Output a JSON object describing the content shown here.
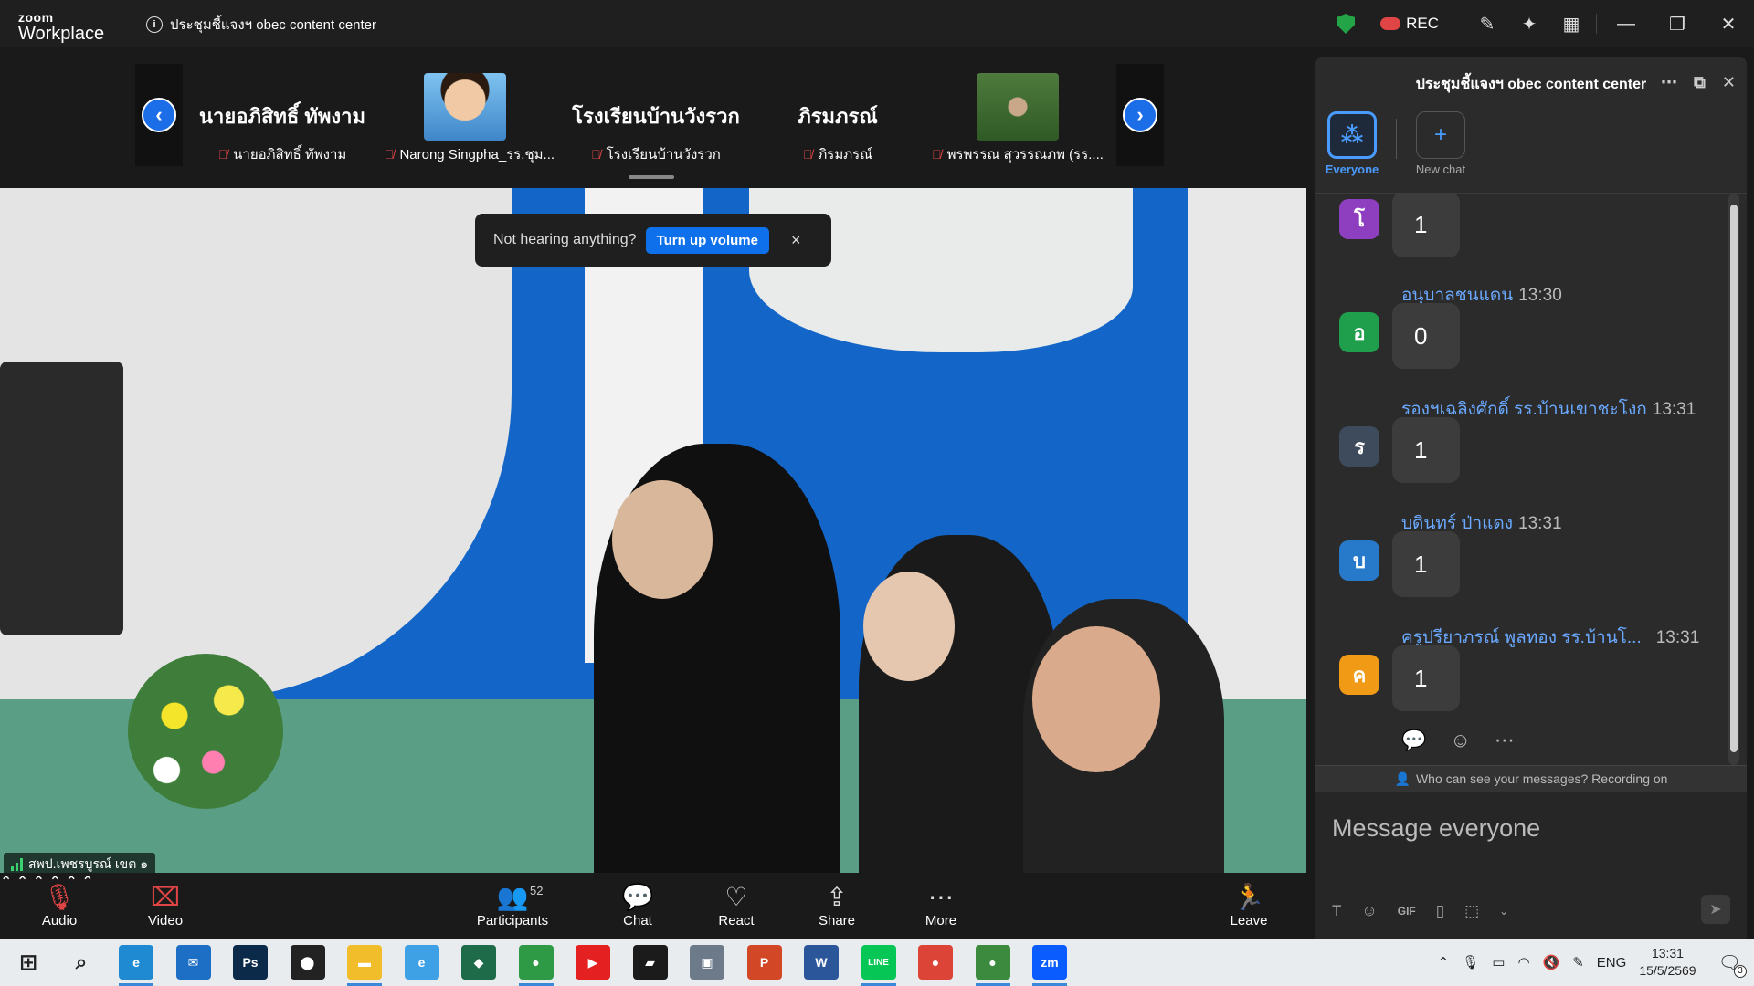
{
  "app": {
    "logo_top": "zoom",
    "logo_bottom": "Workplace",
    "meeting_title": "ประชุมชี้แจงฯ obec content center",
    "rec_label": "REC"
  },
  "thumbnails": [
    {
      "big_name": "นายอภิสิทธิ์ ทัพงาม",
      "label": "นายอภิสิทธิ์ ทัพงาม"
    },
    {
      "big_name": "",
      "label": "Narong Singpha_รร.ชุม..."
    },
    {
      "big_name": "โรงเรียนบ้านวังรวก",
      "label": "โรงเรียนบ้านวังรวก"
    },
    {
      "big_name": "ภิรมภรณ์",
      "label": "ภิรมภรณ์"
    },
    {
      "big_name": "",
      "label": "พรพรรณ สุวรรณภพ (รร...."
    }
  ],
  "toast": {
    "text": "Not hearing anything?",
    "button": "Turn up volume",
    "close": "×"
  },
  "video": {
    "speaker_label": "สพป.เพชรบูรณ์ เขต ๑"
  },
  "controls": {
    "audio": "Audio",
    "video": "Video",
    "participants": "Participants",
    "participants_count": "52",
    "chat": "Chat",
    "react": "React",
    "share": "Share",
    "more": "More",
    "leave": "Leave"
  },
  "chat_panel": {
    "title": "ประชุมชี้แจงฯ obec content center",
    "tabs": [
      {
        "label": "Everyone"
      },
      {
        "label": "New chat"
      }
    ],
    "messages": [
      {
        "initial": "โ",
        "color": "#8e3fbf",
        "name": "",
        "time": "",
        "text": "1"
      },
      {
        "initial": "อ",
        "color": "#1f9e4c",
        "name": "อนุบาลชนแดน",
        "time": "13:30",
        "text": "0"
      },
      {
        "initial": "ร",
        "color": "#3d4b5c",
        "name": "รองฯเฉลิงศักดิ์ รร.บ้านเขาชะโงก",
        "time": "13:31",
        "text": "1"
      },
      {
        "initial": "บ",
        "color": "#2779c9",
        "name": "บดินทร์ ป่าแดง",
        "time": "13:31",
        "text": "1"
      },
      {
        "initial": "ค",
        "color": "#f09a16",
        "name": "ครูปรียาภรณ์ พูลทอง รร.บ้านโ...",
        "time": "13:31",
        "text": "1"
      }
    ],
    "visibility_text": "Who can see your messages? Recording on",
    "compose_placeholder": "Message everyone",
    "gif": "GIF"
  },
  "taskbar": {
    "lang": "ENG",
    "time": "13:31",
    "date": "15/5/2569",
    "notif_count": "3",
    "apps": [
      {
        "name": "edge-icon",
        "color": "#1f8ad2",
        "glyph": "e"
      },
      {
        "name": "mail-icon",
        "color": "#1c6fc4",
        "glyph": "✉"
      },
      {
        "name": "photoshop-icon",
        "color": "#0b2a4a",
        "glyph": "Ps"
      },
      {
        "name": "maps-icon",
        "color": "#222222",
        "glyph": "⬤"
      },
      {
        "name": "explorer-icon",
        "color": "#f2bd2a",
        "glyph": "▬"
      },
      {
        "name": "ie-icon",
        "color": "#3ea0e5",
        "glyph": "e"
      },
      {
        "name": "app-icon",
        "color": "#1e6b4a",
        "glyph": "◆"
      },
      {
        "name": "chrome-icon",
        "color": "#2e9a46",
        "glyph": "●"
      },
      {
        "name": "youtube-icon",
        "color": "#e52020",
        "glyph": "▶"
      },
      {
        "name": "sticky-notes-icon",
        "color": "#1b1b1b",
        "glyph": "▰"
      },
      {
        "name": "media-icon",
        "color": "#6c7a8a",
        "glyph": "▣"
      },
      {
        "name": "powerpoint-icon",
        "color": "#d24726",
        "glyph": "P"
      },
      {
        "name": "word-icon",
        "color": "#2b579a",
        "glyph": "W"
      },
      {
        "name": "line-icon",
        "color": "#06c755",
        "glyph": "LINE"
      },
      {
        "name": "chrome-icon-2",
        "color": "#db4437",
        "glyph": "●"
      },
      {
        "name": "chrome-icon-3",
        "color": "#3b8a3e",
        "glyph": "●"
      },
      {
        "name": "zoom-icon",
        "color": "#0b5cff",
        "glyph": "zm"
      }
    ]
  }
}
